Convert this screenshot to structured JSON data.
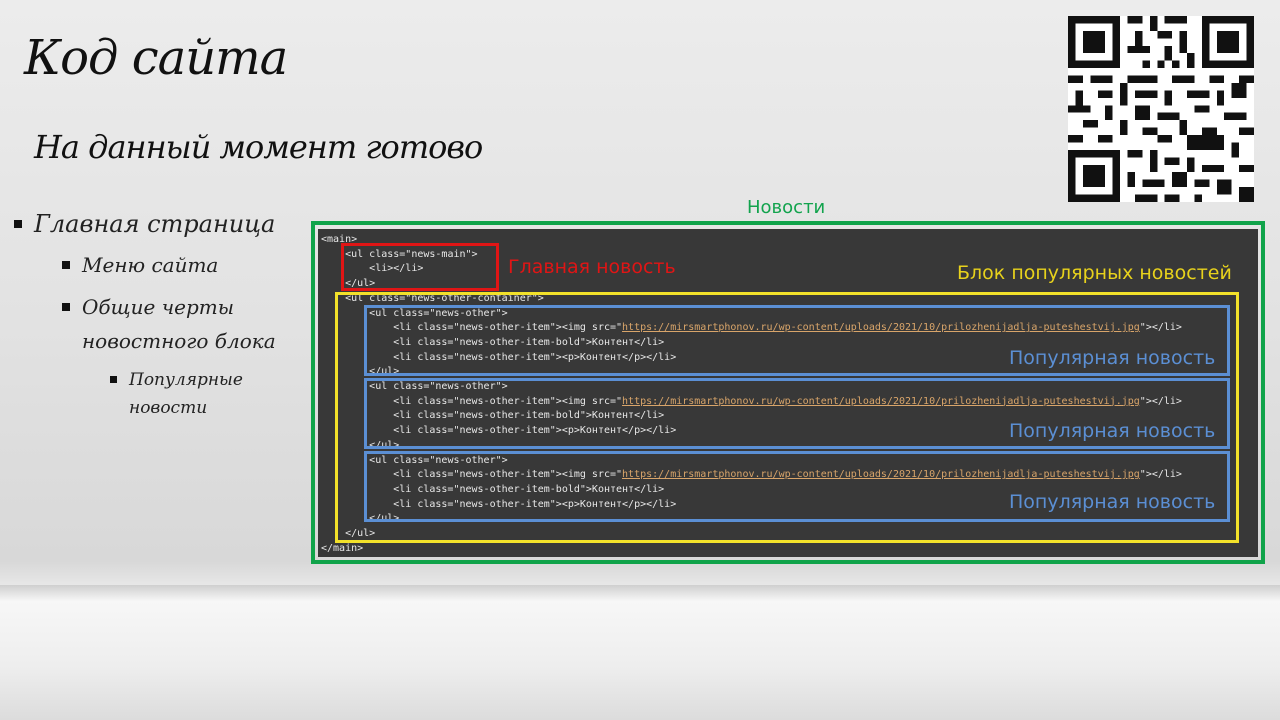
{
  "slide": {
    "title": "Код сайта",
    "subtitle": "На данный момент готово"
  },
  "bullets": {
    "level1": "Главная страница",
    "level2": [
      "Меню сайта",
      "Общие черты новостного блока"
    ],
    "level3": "Популярные новости"
  },
  "annotations": {
    "news": "Новости",
    "main_news": "Главная новость",
    "popular_block": "Блок популярных новостей",
    "popular_item": "Популярная новость"
  },
  "code": {
    "main_open": "<main>",
    "ul_main_open": "<ul class=\"news-main\">",
    "li_empty": "<li></li>",
    "ul_close": "</ul>",
    "ul_container_open": "<ul class=\"news-other-container\">",
    "ul_other_open": "<ul class=\"news-other\">",
    "li_item_open": "<li class=\"news-other-item\"><img src=\"",
    "img_url": "https://mirsmartphonov.ru/wp-content/uploads/2021/10/prilozhenijadlja-puteshestvij.jpg",
    "li_item_close": "\"></li>",
    "li_bold": "<li class=\"news-other-item-bold\">Контент</li>",
    "li_p": "<li class=\"news-other-item\"><p>Контент</p></li>",
    "main_close": "</main>"
  },
  "colors": {
    "green": "#10a34a",
    "red": "#e01515",
    "yellow": "#f2e12a",
    "blue": "#5b8fd4",
    "code_bg": "#383838"
  }
}
